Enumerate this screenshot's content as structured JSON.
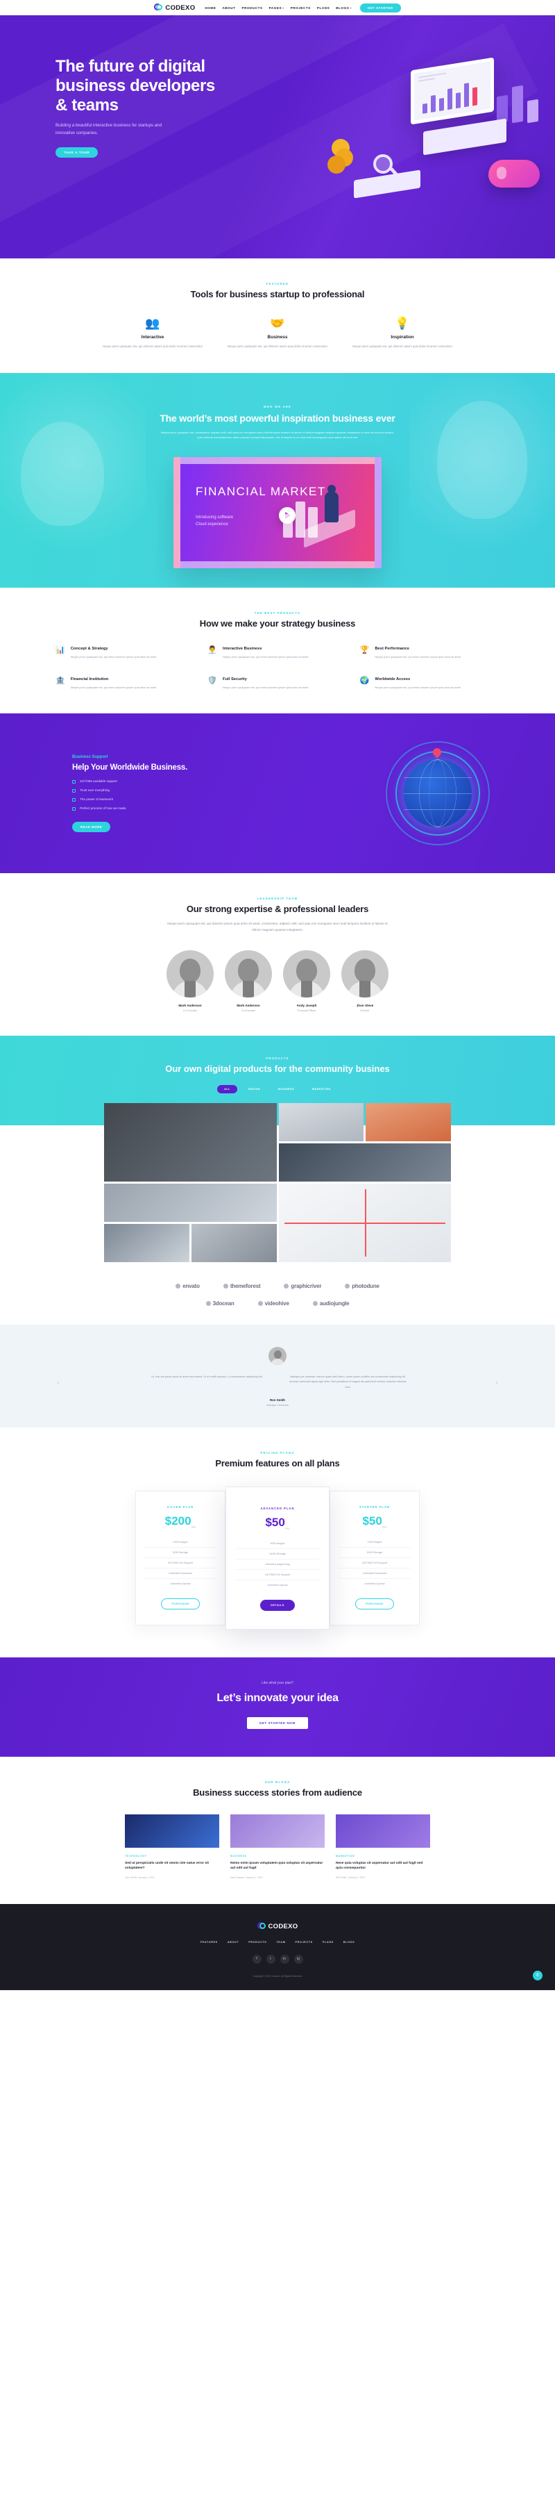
{
  "header": {
    "brand": "CODEXO",
    "nav": [
      {
        "label": "HOME",
        "caret": false
      },
      {
        "label": "ABOUT",
        "caret": false
      },
      {
        "label": "PRODUCTS",
        "caret": false
      },
      {
        "label": "PAGES",
        "caret": true
      },
      {
        "label": "PROJECTS",
        "caret": false
      },
      {
        "label": "PLANS",
        "caret": false
      },
      {
        "label": "BLOGS",
        "caret": true
      }
    ],
    "cta": "GET STARTED"
  },
  "hero": {
    "title": "The future of digital business developers & teams",
    "subtitle": "Building a beautiful interactive business for startups and innovative companies.",
    "button": "TAKE A TOUR"
  },
  "featured": {
    "eyebrow": "FEATURED",
    "title": "Tools for business startup to professional",
    "cards": [
      {
        "icon": "team-icon",
        "emoji": "👥",
        "title": "Interactive",
        "text": "Neque porro quisquam est, qui dolorem ipsum quia dolor sit amet consectetur"
      },
      {
        "icon": "handshake-icon",
        "emoji": "🤝",
        "title": "Business",
        "text": "Neque porro quisquam est, qui dolorem ipsum quia dolor sit amet consectetur"
      },
      {
        "icon": "lightbulb-icon",
        "emoji": "💡",
        "title": "Inspiration",
        "text": "Neque porro quisquam est, qui dolorem ipsum quia dolor sit amet consectetur"
      }
    ]
  },
  "whoweare": {
    "eyebrow": "WHO WE ARE",
    "title": "The world’s most powerful inspiration business ever",
    "text": "Neque porro quisquam est, consectetur, adipisci velit, sed quia non numquam eius modi tempora incidunt ut labore et dolore magnam aliquam quaerat voluptatem ut enim ad minima veniam, quis nostrum exercitationem ullam corporis suscipit laboriosam, nisi ut aliquid ex ea commodi consequatur quis autem vel eum iure",
    "video_title": "FINANCIAL MARKET",
    "video_sub": "Introducing software\nCloud experience"
  },
  "strategy": {
    "eyebrow": "THE BEST PRODUCTS",
    "title": "How we make your strategy business",
    "items": [
      {
        "icon": "chart-icon",
        "emoji": "📊",
        "title": "Concept & Strategy",
        "text": "Neque porro quisquam est, qui lorem dolorem ipsum quia dolor sit amet"
      },
      {
        "icon": "meeting-icon",
        "emoji": "👨‍💼",
        "title": "Interactive Business",
        "text": "Neque porro quisquam est, qui lorem dolorem ipsum quia dolor sit amet"
      },
      {
        "icon": "trophy-icon",
        "emoji": "🏆",
        "title": "Best Performance",
        "text": "Neque porro quisquam est, qui lorem dolorem ipsum quia dolor sit amet"
      },
      {
        "icon": "bank-icon",
        "emoji": "🏦",
        "title": "Financial Institution",
        "text": "Neque porro quisquam est, qui lorem dolorem ipsum quia dolor sit amet"
      },
      {
        "icon": "shield-icon",
        "emoji": "🛡️",
        "title": "Full Security",
        "text": "Neque porro quisquam est, qui lorem dolorem ipsum quia dolor sit amet"
      },
      {
        "icon": "globe-icon",
        "emoji": "🌍",
        "title": "Worldwide Access",
        "text": "Neque porro quisquam est, qui lorem dolorem ipsum quia dolor sit amet"
      }
    ]
  },
  "support": {
    "label": "Business Support",
    "title": "Help Your Worldwide Business.",
    "list": [
      "24/7/365 available support",
      "Trust over everything",
      "The power of teamwork",
      "Perfect process of how we made"
    ],
    "button": "READ MORE"
  },
  "team": {
    "eyebrow": "LEADERSHIP TEAM",
    "title": "Our strong expertise & professional leaders",
    "text": "Neque porro quisquam est, qui dolorem ipsum quia dolor sit amet, consectetur, adipisci velit, sed quia non numquam eius modi tempora incidunt ut labore et dolore magnam quaerat voluptatem.",
    "members": [
      {
        "name": "Mark Anderson",
        "role": "Co-Founder"
      },
      {
        "name": "Mark Anderson",
        "role": "Co-Founder"
      },
      {
        "name": "Andy Joseph",
        "role": "Financial Officer"
      },
      {
        "name": "Jhon Steve",
        "role": "Director"
      }
    ]
  },
  "products": {
    "eyebrow": "PRODUCTS",
    "title": "Our own digital products for the community busines",
    "filters": [
      {
        "label": "ALL",
        "active": true
      },
      {
        "label": "DESIGN",
        "active": false
      },
      {
        "label": "BUSINESS",
        "active": false
      },
      {
        "label": "MARKETING",
        "active": false
      }
    ]
  },
  "brands": [
    [
      {
        "name": "envato",
        "mark": "❖"
      },
      {
        "name": "themeforest",
        "mark": "◉"
      },
      {
        "name": "graphicriver",
        "mark": "◆"
      },
      {
        "name": "photodune",
        "mark": "●"
      }
    ],
    [
      {
        "name": "3docean",
        "mark": "▲"
      },
      {
        "name": "videohive",
        "mark": "▶"
      },
      {
        "name": "audiojungle",
        "mark": "♪"
      }
    ]
  ],
  "testimonial": {
    "quotes": [
      "Ut, non est ipsum dolor sit amet sed manus. Ut et mollit rationes. Li consectetuer adipiscing elit.",
      "Natoque per molestie, mauris quam nibh libero, lorem ipsum porttitor est consectetur adipiscing elit. Aenean commodo ligula eget dolor. Nisi penatibus et magnis dis parturient montes nascetur ridiculus mus."
    ],
    "name": "Ron Smith",
    "role": "Manager, Facebook",
    "prev_icon": "chevron-left-icon",
    "next_icon": "chevron-right-icon"
  },
  "pricing": {
    "eyebrow": "PRICING PLANS",
    "title": "Premium features on all plans",
    "plans": [
      {
        "name": "SILVER PLAN",
        "price": "$200",
        "per": "/mo",
        "features": [
          "1GB Images",
          "5GB Storage",
          "24/7/365 Full Support",
          "Unlimited Download",
          "Unlimited Upload"
        ],
        "button": "PURCHASE",
        "featured": false
      },
      {
        "name": "ADVANCED PLAN",
        "price": "$50",
        "per": "/mo",
        "features": [
          "5GB Images",
          "10GB Storage",
          "Unlimited pages blog",
          "24/7/365 Full Support",
          "Unlimited Upload"
        ],
        "button": "DETAILS",
        "featured": true
      },
      {
        "name": "STARTER PLAN",
        "price": "$50",
        "per": "/mo",
        "features": [
          "1GB Images",
          "5GB Storage",
          "24/7/365 Full Support",
          "Unlimited Download",
          "Unlimited Upload"
        ],
        "button": "PURCHASE",
        "featured": false
      }
    ]
  },
  "cta": {
    "small": "Like what your plan?",
    "title": "Let’s innovate your idea",
    "button": "GET STARTED NOW"
  },
  "blog": {
    "eyebrow": "OUR BLOGS",
    "title": "Business success stories from audience",
    "posts": [
      {
        "category": "TECHNOLOGY",
        "title": "Sed ut perspiciatis unde sit omnis iste natus error sit voluptatem?",
        "meta": "Jhon Smith | January 1, 2020"
      },
      {
        "category": "BUSINESS",
        "title": "Nemo enim ipsam voluptatem quia voluptas sit aspernatur aut odit aut fugit",
        "meta": "Mark Wayane | January 1, 2020"
      },
      {
        "category": "MARKETING",
        "title": "Neve quia voluptas sit aspernatur aut odit aut fugit sed quia consequuntur",
        "meta": "Rob Smith | January 1, 2020"
      }
    ]
  },
  "footer": {
    "brand": "CODEXO",
    "nav": [
      "FEATURES",
      "ABOUT",
      "PRODUCTS",
      "TEAM",
      "PROJECTS",
      "PLANS",
      "BLOGS"
    ],
    "socials": [
      "f",
      "t",
      "in",
      "ig"
    ],
    "copyright": "Copyright © 2020 Codexo. All Rights Reserved.",
    "fab_icon": "chat-icon"
  },
  "colors": {
    "purple": "#5c1fcc",
    "teal": "#2ed3dd",
    "dark": "#1b1b24"
  }
}
